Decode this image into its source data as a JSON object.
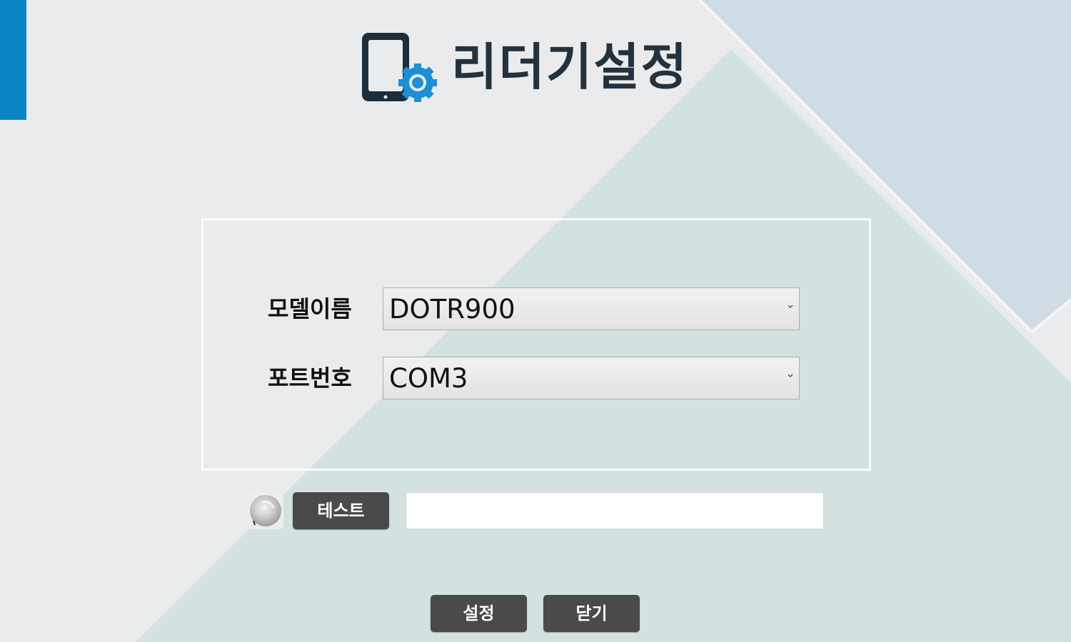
{
  "header": {
    "title": "리더기설정",
    "logo_icon": "tablet-gear-icon"
  },
  "colors": {
    "accent": "#0a86c4",
    "title": "#23323d",
    "button": "#4a4a4a",
    "gear": "#1d8fd4"
  },
  "form": {
    "model": {
      "label": "모델이름",
      "value": "DOTR900"
    },
    "port": {
      "label": "포트번호",
      "value": "COM3"
    }
  },
  "test": {
    "indicator_icon": "status-light-icon",
    "button_label": "테스트",
    "result_value": ""
  },
  "actions": {
    "set_label": "설정",
    "close_label": "닫기"
  }
}
